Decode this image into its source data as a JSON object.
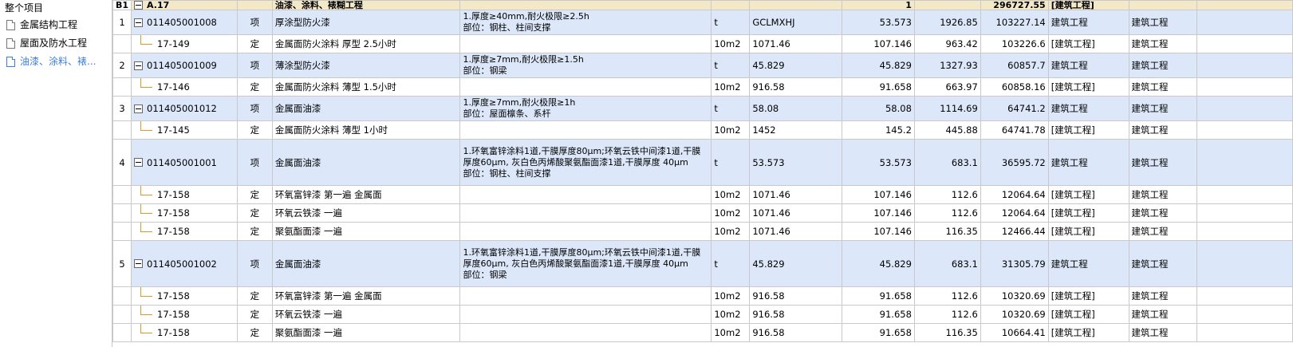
{
  "sidebar": {
    "root": "整个项目",
    "items": [
      {
        "label": "金属结构工程"
      },
      {
        "label": "屋面及防水工程"
      },
      {
        "label": "油漆、涂料、裱..."
      }
    ]
  },
  "header_row": {
    "num": "B1",
    "code": "A.17",
    "name": "油漆、涂料、裱糊工程",
    "qty": "1",
    "total": "296727.55",
    "specialty": "[建筑工程]"
  },
  "rows": [
    {
      "type": "qd",
      "num": "1",
      "code": "011405001008",
      "cat": "项",
      "name": "厚涂型防火漆",
      "feature": "1.厚度≥40mm,耐火极限≥2.5h\n部位：钢柱、柱间支撑",
      "unit": "t",
      "expr": "GCLMXHJ",
      "qty": "53.573",
      "price": "1926.85",
      "total": "103227.14",
      "spec": "建筑工程",
      "spec2": "建筑工程"
    },
    {
      "type": "de",
      "num": "",
      "code": "17-149",
      "cat": "定",
      "name": "金属面防火涂料 厚型 2.5小时",
      "feature": "",
      "unit": "10m2",
      "expr": "1071.46",
      "qty": "107.146",
      "price": "963.42",
      "total": "103226.6",
      "spec": "[建筑工程]",
      "spec2": "建筑工程"
    },
    {
      "type": "qd",
      "num": "2",
      "code": "011405001009",
      "cat": "项",
      "name": "薄涂型防火漆",
      "feature": "1.厚度≥7mm,耐火极限≥1.5h\n部位：钢梁",
      "unit": "t",
      "expr": "45.829",
      "qty": "45.829",
      "price": "1327.93",
      "total": "60857.7",
      "spec": "建筑工程",
      "spec2": "建筑工程"
    },
    {
      "type": "de",
      "num": "",
      "code": "17-146",
      "cat": "定",
      "name": "金属面防火涂料 薄型 1.5小时",
      "feature": "",
      "unit": "10m2",
      "expr": "916.58",
      "qty": "91.658",
      "price": "663.97",
      "total": "60858.16",
      "spec": "[建筑工程]",
      "spec2": "建筑工程"
    },
    {
      "type": "qd",
      "num": "3",
      "code": "011405001012",
      "cat": "项",
      "name": "金属面油漆",
      "feature": "1.厚度≥7mm,耐火极限≥1h\n部位：屋面檩条、系杆",
      "unit": "t",
      "expr": "58.08",
      "qty": "58.08",
      "price": "1114.69",
      "total": "64741.2",
      "spec": "建筑工程",
      "spec2": "建筑工程"
    },
    {
      "type": "de",
      "num": "",
      "code": "17-145",
      "cat": "定",
      "name": "金属面防火涂料 薄型 1小时",
      "feature": "",
      "unit": "10m2",
      "expr": "1452",
      "qty": "145.2",
      "price": "445.88",
      "total": "64741.78",
      "spec": "[建筑工程]",
      "spec2": "建筑工程"
    },
    {
      "type": "qd",
      "num": "4",
      "code": "011405001001",
      "cat": "项",
      "name": "金属面油漆",
      "feature": "1.环氧富锌涂料1道,干膜厚度80μm;环氧云铁中间漆1道,干膜厚度60μm, 灰白色丙烯酸聚氨酯面漆1道,干膜厚度 40μm\n部位：钢柱、柱间支撑",
      "unit": "t",
      "expr": "53.573",
      "qty": "53.573",
      "price": "683.1",
      "total": "36595.72",
      "spec": "建筑工程",
      "spec2": "建筑工程"
    },
    {
      "type": "de",
      "num": "",
      "code": "17-158",
      "cat": "定",
      "name": "环氧富锌漆 第一遍 金属面",
      "feature": "",
      "unit": "10m2",
      "expr": "1071.46",
      "qty": "107.146",
      "price": "112.6",
      "total": "12064.64",
      "spec": "[建筑工程]",
      "spec2": "建筑工程"
    },
    {
      "type": "de",
      "num": "",
      "code": "17-158",
      "cat": "定",
      "name": "环氧云铁漆 一遍",
      "feature": "",
      "unit": "10m2",
      "expr": "1071.46",
      "qty": "107.146",
      "price": "112.6",
      "total": "12064.64",
      "spec": "[建筑工程]",
      "spec2": "建筑工程"
    },
    {
      "type": "de",
      "num": "",
      "code": "17-158",
      "cat": "定",
      "name": "聚氨酯面漆 一遍",
      "feature": "",
      "unit": "10m2",
      "expr": "1071.46",
      "qty": "107.146",
      "price": "116.35",
      "total": "12466.44",
      "spec": "[建筑工程]",
      "spec2": "建筑工程"
    },
    {
      "type": "qd",
      "num": "5",
      "code": "011405001002",
      "cat": "项",
      "name": "金属面油漆",
      "feature": "1.环氧富锌涂料1道,干膜厚度80μm;环氧云铁中间漆1道,干膜厚度60μm, 灰白色丙烯酸聚氨酯面漆1道,干膜厚度 40μm\n部位：钢梁",
      "unit": "t",
      "expr": "45.829",
      "qty": "45.829",
      "price": "683.1",
      "total": "31305.79",
      "spec": "建筑工程",
      "spec2": "建筑工程"
    },
    {
      "type": "de",
      "num": "",
      "code": "17-158",
      "cat": "定",
      "name": "环氧富锌漆 第一遍 金属面",
      "feature": "",
      "unit": "10m2",
      "expr": "916.58",
      "qty": "91.658",
      "price": "112.6",
      "total": "10320.69",
      "spec": "[建筑工程]",
      "spec2": "建筑工程"
    },
    {
      "type": "de",
      "num": "",
      "code": "17-158",
      "cat": "定",
      "name": "环氧云铁漆 一遍",
      "feature": "",
      "unit": "10m2",
      "expr": "916.58",
      "qty": "91.658",
      "price": "112.6",
      "total": "10320.69",
      "spec": "[建筑工程]",
      "spec2": "建筑工程"
    },
    {
      "type": "de",
      "num": "",
      "code": "17-158",
      "cat": "定",
      "name": "聚氨酯面漆 一遍",
      "feature": "",
      "unit": "10m2",
      "expr": "916.58",
      "qty": "91.658",
      "price": "116.35",
      "total": "10664.41",
      "spec": "[建筑工程]",
      "spec2": "建筑工程"
    }
  ],
  "colors": {
    "qd_row": "#dce8fa",
    "header_row": "#f3e9c9",
    "active_tree": "#3d7ddd",
    "branch_line": "#d69b2c"
  }
}
